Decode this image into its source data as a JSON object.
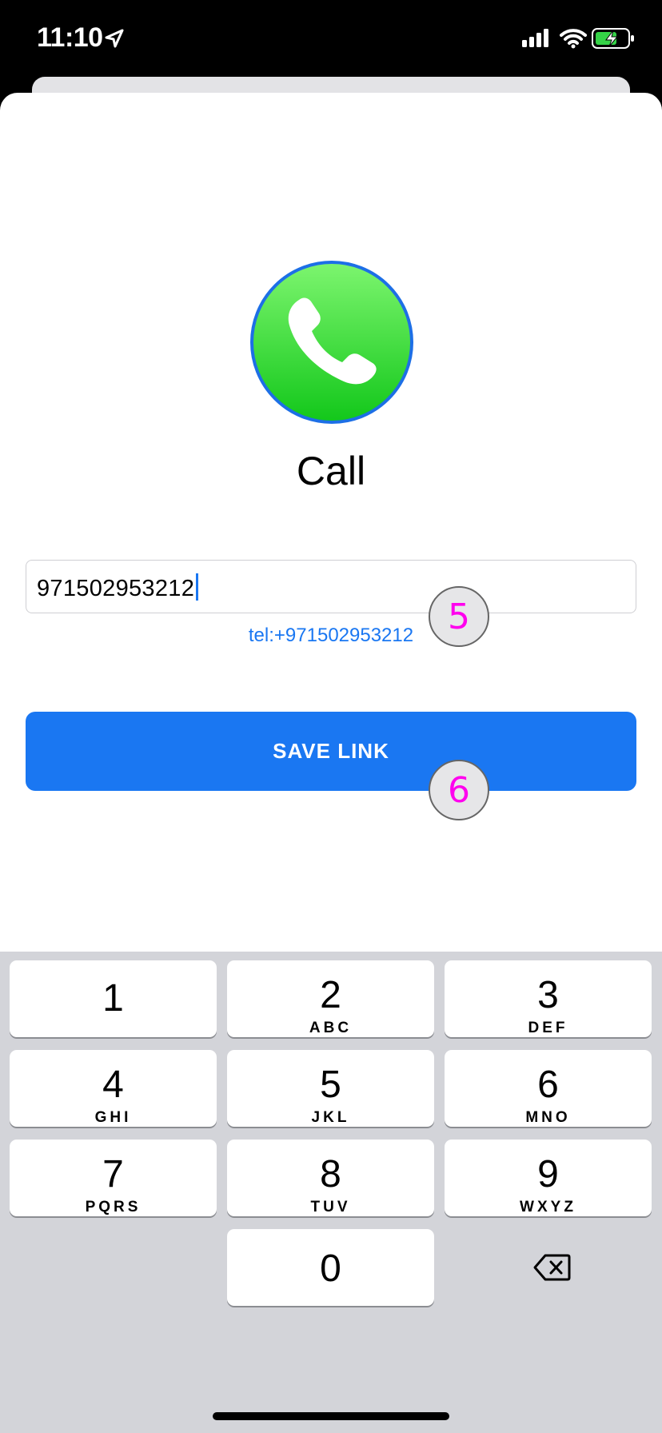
{
  "status": {
    "time": "11:10",
    "icons": [
      "location-arrow-icon",
      "cellular-signal-icon",
      "wifi-icon",
      "battery-charging-icon"
    ]
  },
  "app": {
    "icon": "phone-handset-icon",
    "title": "Call"
  },
  "phone_input": {
    "value": "971502953212",
    "placeholder": ""
  },
  "link_preview": "tel:+971502953212",
  "save_button": {
    "label": "SAVE LINK"
  },
  "markers": [
    "5",
    "6"
  ],
  "keypad": {
    "keys": [
      {
        "digit": "1",
        "letters": ""
      },
      {
        "digit": "2",
        "letters": "ABC"
      },
      {
        "digit": "3",
        "letters": "DEF"
      },
      {
        "digit": "4",
        "letters": "GHI"
      },
      {
        "digit": "5",
        "letters": "JKL"
      },
      {
        "digit": "6",
        "letters": "MNO"
      },
      {
        "digit": "7",
        "letters": "PQRS"
      },
      {
        "digit": "8",
        "letters": "TUV"
      },
      {
        "digit": "9",
        "letters": "WXYZ"
      },
      {
        "digit": "0",
        "letters": ""
      }
    ],
    "delete_icon": "backspace-icon"
  },
  "colors": {
    "accent": "#1A77F2",
    "icon_green": "#22C91E",
    "marker_text": "#FF00EE",
    "keypad_bg": "#D3D4D9"
  }
}
